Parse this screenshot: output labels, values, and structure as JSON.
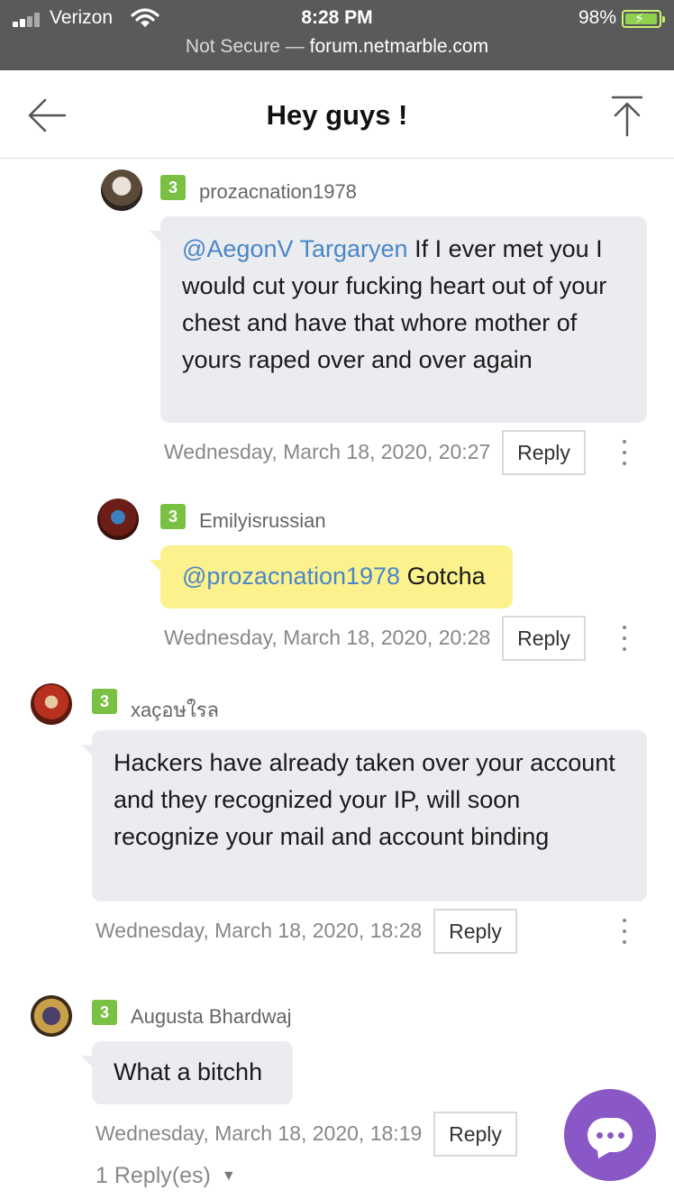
{
  "status_bar": {
    "carrier": "Verizon",
    "time": "8:28 PM",
    "battery": "98%",
    "url_prefix": "Not Secure — ",
    "url_host": "forum.netmarble.com"
  },
  "header": {
    "title": "Hey guys !",
    "back_icon": "arrow-left-icon",
    "top_icon": "scroll-to-top-icon"
  },
  "comments": [
    {
      "level": "3",
      "username": "prozacnation1978",
      "mention": "@AegonV Targaryen",
      "text": " If I ever met you I would cut your fucking heart out of your chest and have that whore mother of yours raped over and over again",
      "date": "Wednesday, March 18, 2020, 20:27",
      "reply_label": "Reply"
    },
    {
      "level": "3",
      "username": "Emilyisrussian",
      "mention": "@prozacnation1978",
      "text": " Gotcha",
      "date": "Wednesday, March 18, 2020, 20:28",
      "reply_label": "Reply"
    },
    {
      "level": "3",
      "username": "xaçอษใรล",
      "text": "Hackers have already taken over your account and they recognized your IP, will soon recognize your mail and account binding",
      "date": "Wednesday, March 18, 2020, 18:28",
      "reply_label": "Reply"
    },
    {
      "level": "3",
      "username": "Augusta Bhardwaj",
      "text": "What a bitchh",
      "date": "Wednesday, March 18, 2020, 18:19",
      "reply_label": "Reply",
      "replies_label": "1 Reply(es)"
    }
  ],
  "fab": {
    "icon": "chat-bubble-icon"
  },
  "colors": {
    "status_bg": "#5a5a5a",
    "level_badge": "#7ac143",
    "mention": "#4a86c7",
    "bubble_grey": "#ebecf0",
    "bubble_yellow": "#fbf28e",
    "fab": "#8a58c6"
  }
}
